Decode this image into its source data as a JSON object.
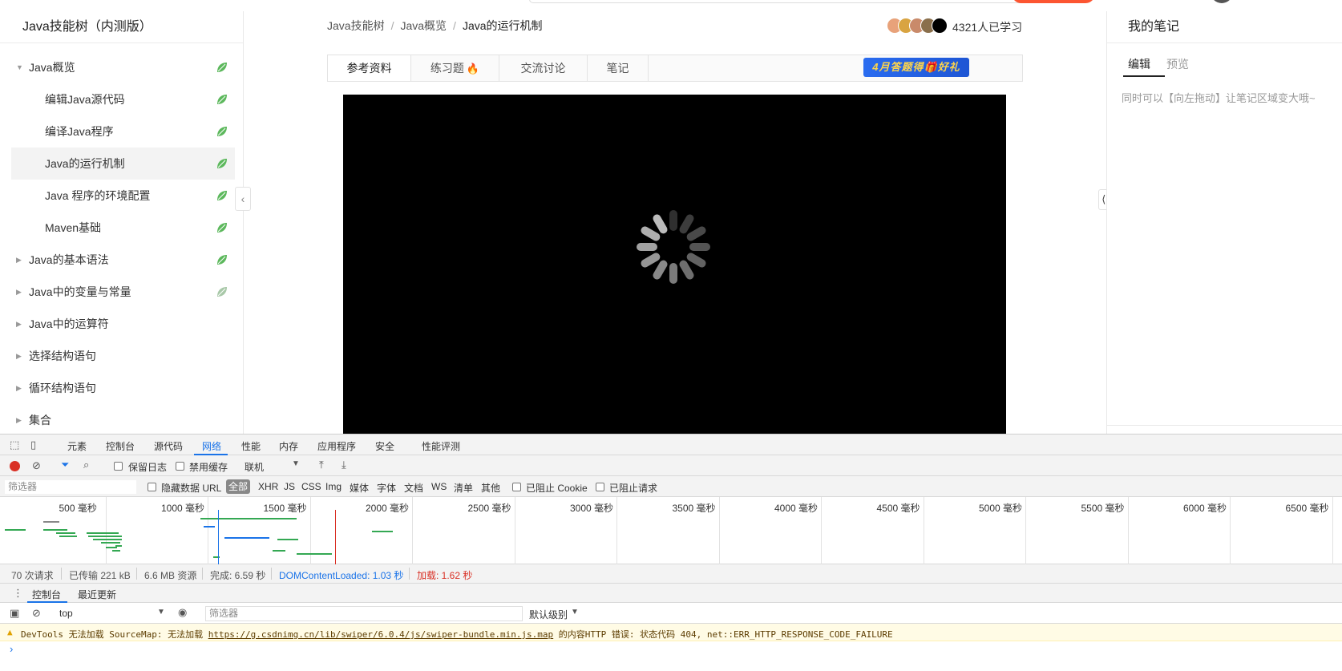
{
  "sidebar": {
    "title": "Java技能树（内测版）",
    "items": [
      {
        "label": "Java概览",
        "level": 0,
        "caret": "▼",
        "leaf_color": "#5cb85c"
      },
      {
        "label": "编辑Java源代码",
        "level": 1,
        "leaf_color": "#5cb85c"
      },
      {
        "label": "编译Java程序",
        "level": 1,
        "leaf_color": "#5cb85c"
      },
      {
        "label": "Java的运行机制",
        "level": 1,
        "active": true,
        "leaf_color": "#5cb85c"
      },
      {
        "label": "Java 程序的环境配置",
        "level": 1,
        "leaf_color": "#5cb85c"
      },
      {
        "label": "Maven基础",
        "level": 1,
        "leaf_color": "#5cb85c"
      },
      {
        "label": "Java的基本语法",
        "level": 0,
        "caret": "▶",
        "leaf_color": "#5cb85c"
      },
      {
        "label": "Java中的变量与常量",
        "level": 0,
        "caret": "▶",
        "leaf_color": "#a8c8a8"
      },
      {
        "label": "Java中的运算符",
        "level": 0,
        "caret": "▶"
      },
      {
        "label": "选择结构语句",
        "level": 0,
        "caret": "▶"
      },
      {
        "label": "循环结构语句",
        "level": 0,
        "caret": "▶"
      },
      {
        "label": "集合",
        "level": 0,
        "caret": "▶"
      }
    ]
  },
  "breadcrumb": {
    "items": [
      "Java技能树",
      "Java概览",
      "Java的运行机制"
    ]
  },
  "learners": {
    "count_text": "4321人已学习"
  },
  "tabs": {
    "items": [
      "参考资料",
      "练习题",
      "交流讨论",
      "笔记"
    ],
    "fire_icon": "🔥",
    "promo": "4月答题得🎁好礼"
  },
  "notes": {
    "title": "我的笔记",
    "tabs": [
      "编辑",
      "预览"
    ],
    "hint": "同时可以【向左拖动】让笔记区域变大哦~"
  },
  "devtools": {
    "tabs": [
      "元素",
      "控制台",
      "源代码",
      "网络",
      "性能",
      "内存",
      "应用程序",
      "安全",
      "性能评测"
    ],
    "active_tab": "网络",
    "toolbar": {
      "preserve_log": "保留日志",
      "disable_cache": "禁用缓存",
      "throttle": "联机"
    },
    "filter": {
      "placeholder": "筛选器",
      "hide_data_urls": "隐藏数据 URL",
      "types": [
        "全部",
        "XHR",
        "JS",
        "CSS",
        "Img",
        "媒体",
        "字体",
        "文档",
        "WS",
        "清单",
        "其他"
      ],
      "blocked_cookies": "已阻止 Cookie",
      "blocked_requests": "已阻止请求"
    },
    "timeline_ticks": [
      "500 毫秒",
      "1000 毫秒",
      "1500 毫秒",
      "2000 毫秒",
      "2500 毫秒",
      "3000 毫秒",
      "3500 毫秒",
      "4000 毫秒",
      "4500 毫秒",
      "5000 毫秒",
      "5500 毫秒",
      "6000 毫秒",
      "6500 毫秒"
    ],
    "summary": {
      "requests": "70 次请求",
      "transferred": "已传输 221 kB",
      "resources": "6.6 MB 资源",
      "finish": "完成: 6.59 秒",
      "dom_loaded": "DOMContentLoaded: 1.03 秒",
      "load": "加载: 1.62 秒",
      "dom_color": "#1a73e8",
      "load_color": "#d93025"
    },
    "drawer_tabs": [
      "控制台",
      "最近更新"
    ],
    "console": {
      "context": "top",
      "filter_placeholder": "筛选器",
      "level": "默认级别",
      "warning_prefix": "DevTools 无法加载 SourceMap: 无法加载 ",
      "warning_link": "https://g.csdnimg.cn/lib/swiper/6.0.4/js/swiper-bundle.min.js.map",
      "warning_suffix": " 的内容HTTP 错误: 状态代码 404, net::ERR_HTTP_RESPONSE_CODE_FAILURE",
      "prompt": "›"
    }
  }
}
